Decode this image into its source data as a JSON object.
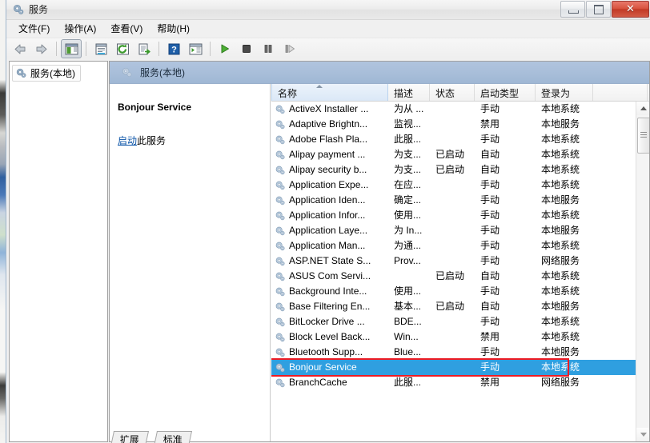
{
  "window": {
    "title": "服务",
    "icon": "services-gear-icon",
    "buttons": {
      "minimize": "最小化",
      "maximize": "最大化",
      "close": "关闭",
      "close_glyph": "✕"
    }
  },
  "menubar": {
    "items": [
      {
        "label": "文件(F)",
        "name": "menu-file"
      },
      {
        "label": "操作(A)",
        "name": "menu-action"
      },
      {
        "label": "查看(V)",
        "name": "menu-view"
      },
      {
        "label": "帮助(H)",
        "name": "menu-help"
      }
    ]
  },
  "toolbar": {
    "items": [
      {
        "name": "back-icon",
        "title": "后退"
      },
      {
        "name": "forward-icon",
        "title": "前进"
      },
      {
        "name": "show-hide-tree-icon",
        "title": "显示/隐藏控制台树",
        "pressed": true
      },
      {
        "name": "properties-icon",
        "title": "属性"
      },
      {
        "name": "refresh-icon",
        "title": "刷新"
      },
      {
        "name": "export-list-icon",
        "title": "导出列表"
      },
      {
        "name": "help-icon",
        "title": "帮助"
      },
      {
        "name": "show-action-pane-icon",
        "title": "显示/隐藏操作窗格"
      },
      {
        "name": "start-service-icon",
        "title": "启动服务"
      },
      {
        "name": "stop-service-icon",
        "title": "停止服务"
      },
      {
        "name": "pause-service-icon",
        "title": "暂停服务"
      },
      {
        "name": "restart-service-icon",
        "title": "重启动服务"
      }
    ]
  },
  "tree": {
    "items": [
      {
        "label": "服务(本地)",
        "icon": "services-gear-icon",
        "selected": true
      }
    ]
  },
  "pane": {
    "header": "服务(本地)",
    "header_icon": "services-gear-icon"
  },
  "details": {
    "service_name": "Bonjour Service",
    "action_link": "启动",
    "action_suffix": "此服务"
  },
  "list": {
    "columns": [
      {
        "label": "名称",
        "key": "name",
        "sorted": true,
        "sort_dir": "asc"
      },
      {
        "label": "描述",
        "key": "description"
      },
      {
        "label": "状态",
        "key": "status"
      },
      {
        "label": "启动类型",
        "key": "startup_type"
      },
      {
        "label": "登录为",
        "key": "log_on_as"
      },
      {
        "label": "",
        "key": "pad"
      }
    ],
    "rows": [
      {
        "name": "ActiveX Installer ...",
        "description": "为从 ...",
        "status": "",
        "startup_type": "手动",
        "log_on_as": "本地系统",
        "selected": false
      },
      {
        "name": "Adaptive Brightn...",
        "description": "监视...",
        "status": "",
        "startup_type": "禁用",
        "log_on_as": "本地服务",
        "selected": false
      },
      {
        "name": "Adobe Flash Pla...",
        "description": "此服...",
        "status": "",
        "startup_type": "手动",
        "log_on_as": "本地系统",
        "selected": false
      },
      {
        "name": "Alipay payment ...",
        "description": "为支...",
        "status": "已启动",
        "startup_type": "自动",
        "log_on_as": "本地系统",
        "selected": false
      },
      {
        "name": "Alipay security b...",
        "description": "为支...",
        "status": "已启动",
        "startup_type": "自动",
        "log_on_as": "本地系统",
        "selected": false
      },
      {
        "name": "Application Expe...",
        "description": "在应...",
        "status": "",
        "startup_type": "手动",
        "log_on_as": "本地系统",
        "selected": false
      },
      {
        "name": "Application Iden...",
        "description": "确定...",
        "status": "",
        "startup_type": "手动",
        "log_on_as": "本地服务",
        "selected": false
      },
      {
        "name": "Application Infor...",
        "description": "使用...",
        "status": "",
        "startup_type": "手动",
        "log_on_as": "本地系统",
        "selected": false
      },
      {
        "name": "Application Laye...",
        "description": "为 In...",
        "status": "",
        "startup_type": "手动",
        "log_on_as": "本地服务",
        "selected": false
      },
      {
        "name": "Application Man...",
        "description": "为通...",
        "status": "",
        "startup_type": "手动",
        "log_on_as": "本地系统",
        "selected": false
      },
      {
        "name": "ASP.NET State S...",
        "description": "Prov...",
        "status": "",
        "startup_type": "手动",
        "log_on_as": "网络服务",
        "selected": false
      },
      {
        "name": "ASUS Com Servi...",
        "description": "",
        "status": "已启动",
        "startup_type": "自动",
        "log_on_as": "本地系统",
        "selected": false
      },
      {
        "name": "Background Inte...",
        "description": "使用...",
        "status": "",
        "startup_type": "手动",
        "log_on_as": "本地系统",
        "selected": false
      },
      {
        "name": "Base Filtering En...",
        "description": "基本...",
        "status": "已启动",
        "startup_type": "自动",
        "log_on_as": "本地服务",
        "selected": false
      },
      {
        "name": "BitLocker Drive ...",
        "description": "BDE...",
        "status": "",
        "startup_type": "手动",
        "log_on_as": "本地系统",
        "selected": false
      },
      {
        "name": "Block Level Back...",
        "description": "Win...",
        "status": "",
        "startup_type": "禁用",
        "log_on_as": "本地系统",
        "selected": false
      },
      {
        "name": "Bluetooth Supp...",
        "description": "Blue...",
        "status": "",
        "startup_type": "手动",
        "log_on_as": "本地服务",
        "selected": false
      },
      {
        "name": "Bonjour Service",
        "description": "",
        "status": "",
        "startup_type": "手动",
        "log_on_as": "本地系统",
        "selected": true
      },
      {
        "name": "BranchCache",
        "description": "此服...",
        "status": "",
        "startup_type": "禁用",
        "log_on_as": "网络服务",
        "selected": false
      }
    ]
  },
  "tabs": [
    {
      "label": "扩展",
      "active": false
    },
    {
      "label": "标准",
      "active": true
    }
  ],
  "colors": {
    "selection_blue": "#2f9fe0",
    "annotation_red": "#ec1c24",
    "pane_header_blue": "#b0c4de",
    "link_blue": "#0b54a8"
  }
}
